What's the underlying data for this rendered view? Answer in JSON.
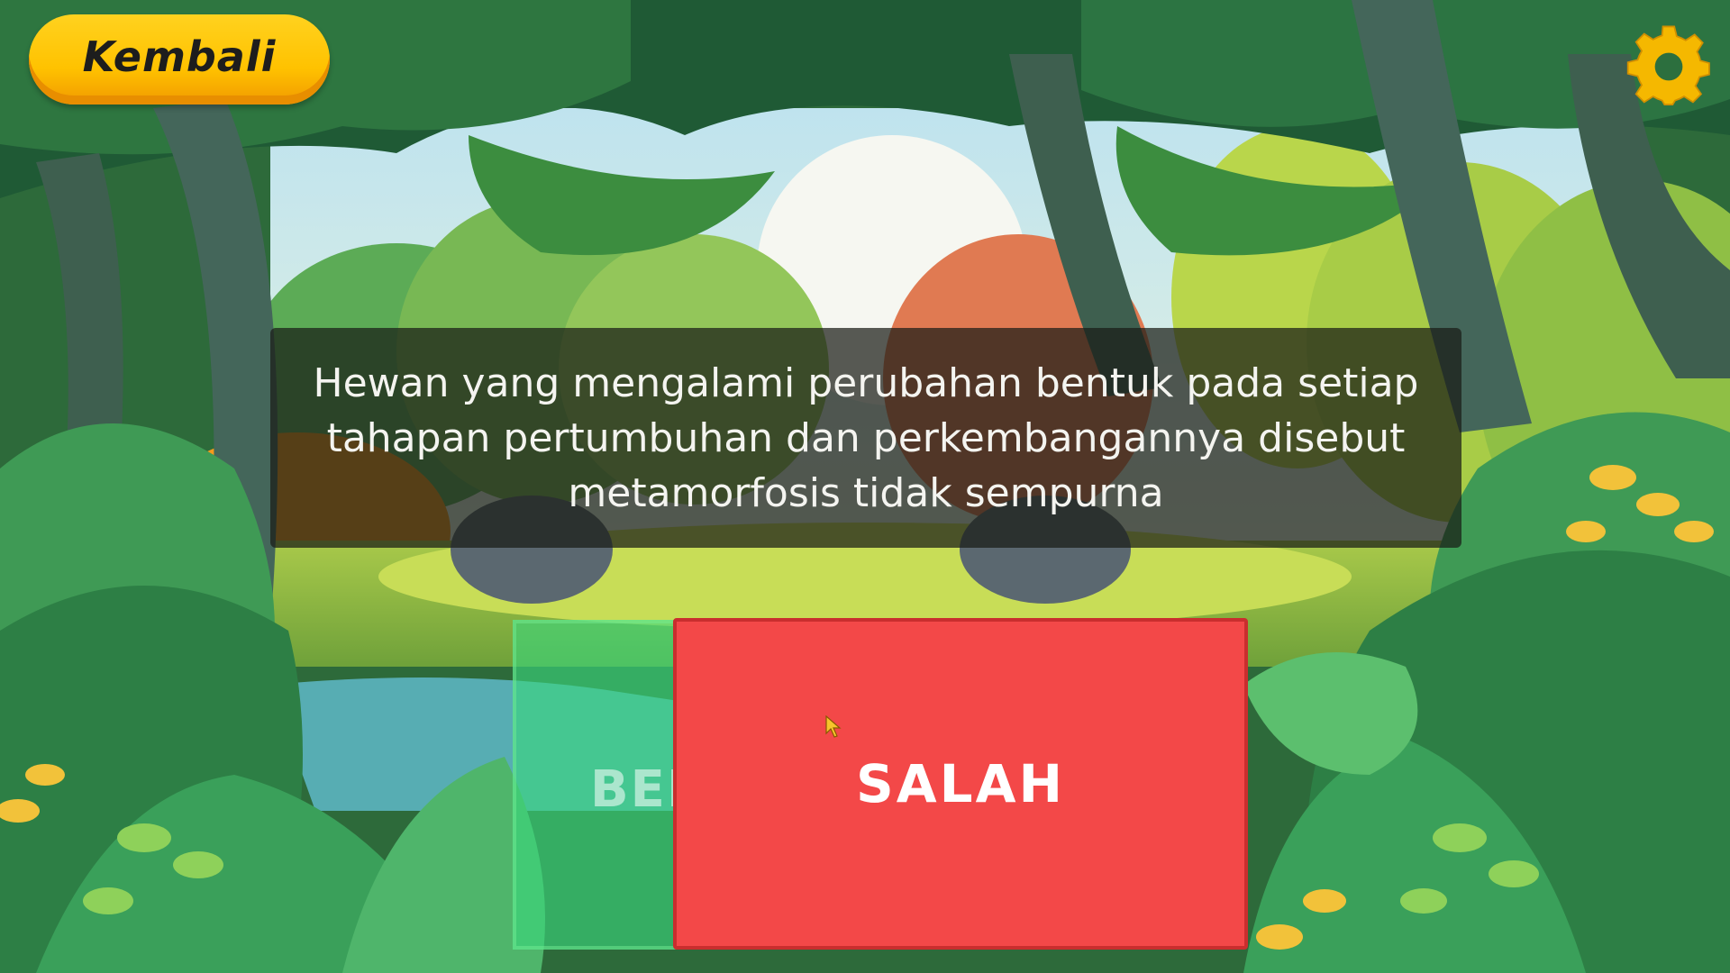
{
  "header": {
    "back_label": "Kembali"
  },
  "settings": {
    "icon": "gear-icon",
    "color": "#f5b800"
  },
  "question": {
    "text": "Hewan yang mengalami perubahan bentuk pada setiap\ntahapan pertumbuhan dan perkembangannya disebut\nmetamorfosis tidak sempurna"
  },
  "answers": {
    "true_label": "BENAR",
    "false_label": "SALAH",
    "true_color": "#3ad67c",
    "false_color": "#f34848"
  }
}
